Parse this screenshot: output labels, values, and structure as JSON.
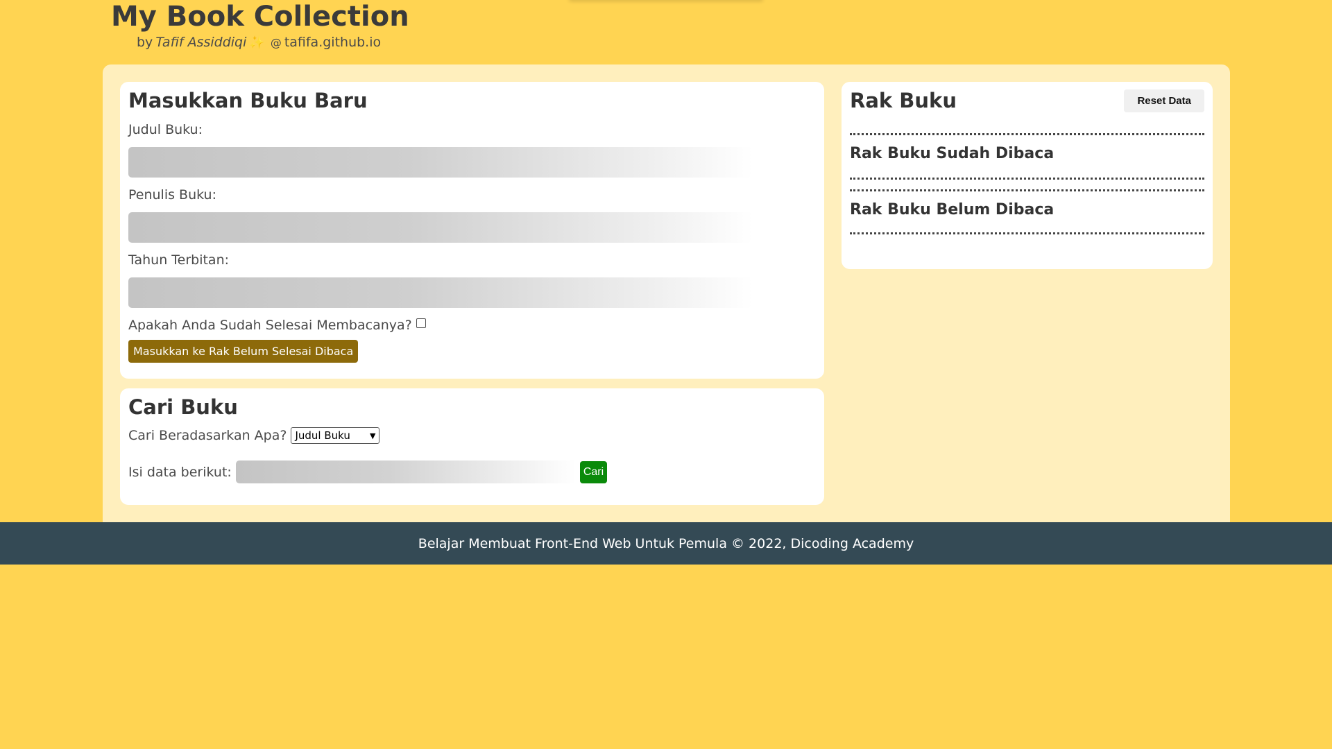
{
  "header": {
    "title": "My Book Collection",
    "by": "by",
    "author": "Tafif Assiddiqi",
    "sparkle": "✨",
    "at": "@",
    "site": "tafifa.github.io"
  },
  "input_section": {
    "title": "Masukkan Buku Baru",
    "title_label": "Judul Buku:",
    "author_label": "Penulis Buku:",
    "year_label": "Tahun Terbitan:",
    "finished_label": "Apakah Anda Sudah Selesai Membacanya?",
    "submit_label": "Masukkan ke Rak Belum Selesai Dibaca"
  },
  "search_section": {
    "title": "Cari Buku",
    "criteria_label": "Cari Beradasarkan Apa?",
    "criteria_selected": "Judul Buku",
    "query_label": "Isi data berikut:",
    "search_button": "Cari"
  },
  "shelf": {
    "title": "Rak Buku",
    "reset_button": "Reset Data",
    "finished_title": "Rak Buku Sudah Dibaca",
    "unfinished_title": "Rak Buku Belum Dibaca"
  },
  "footer": {
    "text": "Belajar Membuat Front-End Web Untuk Pemula © 2022, Dicoding Academy"
  },
  "colors": {
    "background": "#ffd452",
    "panel": "#ffefbd",
    "submit": "#8d6a0a",
    "search": "#0a8a0a",
    "footer": "#344a55"
  }
}
